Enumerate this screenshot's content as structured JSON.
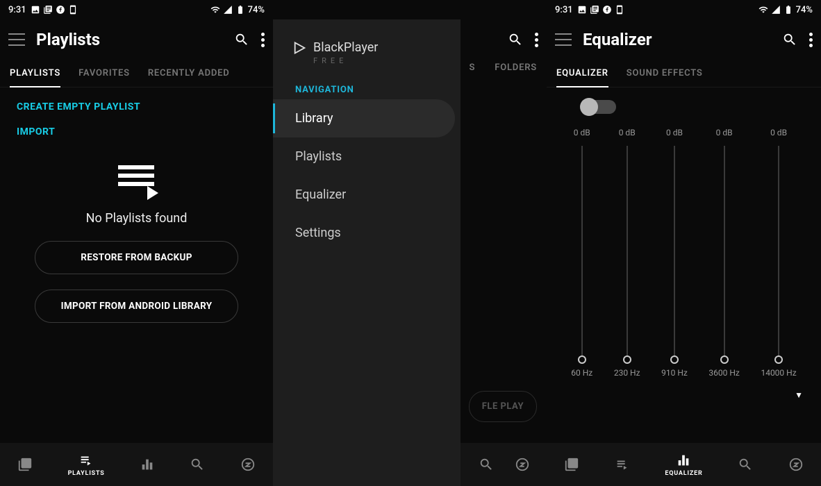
{
  "status": {
    "time": "9:31",
    "battery": "74%"
  },
  "screen1": {
    "title": "Playlists",
    "tabs": [
      "PLAYLISTS",
      "FAVORITES",
      "RECENTLY ADDED"
    ],
    "create": "CREATE EMPTY PLAYLIST",
    "import": "IMPORT",
    "empty": "No Playlists found",
    "restore": "RESTORE FROM BACKUP",
    "importLib": "IMPORT FROM ANDROID LIBRARY",
    "navLabel": "PLAYLISTS"
  },
  "screen2": {
    "brand": "BlackPlayer",
    "brandSub": "FREE",
    "section": "NAVIGATION",
    "items": [
      "Library",
      "Playlists",
      "Equalizer",
      "Settings"
    ],
    "behindTabFolders": "FOLDERS",
    "behindBtn": "FLE PLAY"
  },
  "screen3": {
    "title": "Equalizer",
    "tabs": [
      "EQUALIZER",
      "SOUND EFFECTS"
    ],
    "bands": [
      {
        "db": "0 dB",
        "hz": "60 Hz"
      },
      {
        "db": "0 dB",
        "hz": "230 Hz"
      },
      {
        "db": "0 dB",
        "hz": "910 Hz"
      },
      {
        "db": "0 dB",
        "hz": "3600 Hz"
      },
      {
        "db": "0 dB",
        "hz": "14000 Hz"
      }
    ],
    "navLabel": "EQUALIZER"
  }
}
